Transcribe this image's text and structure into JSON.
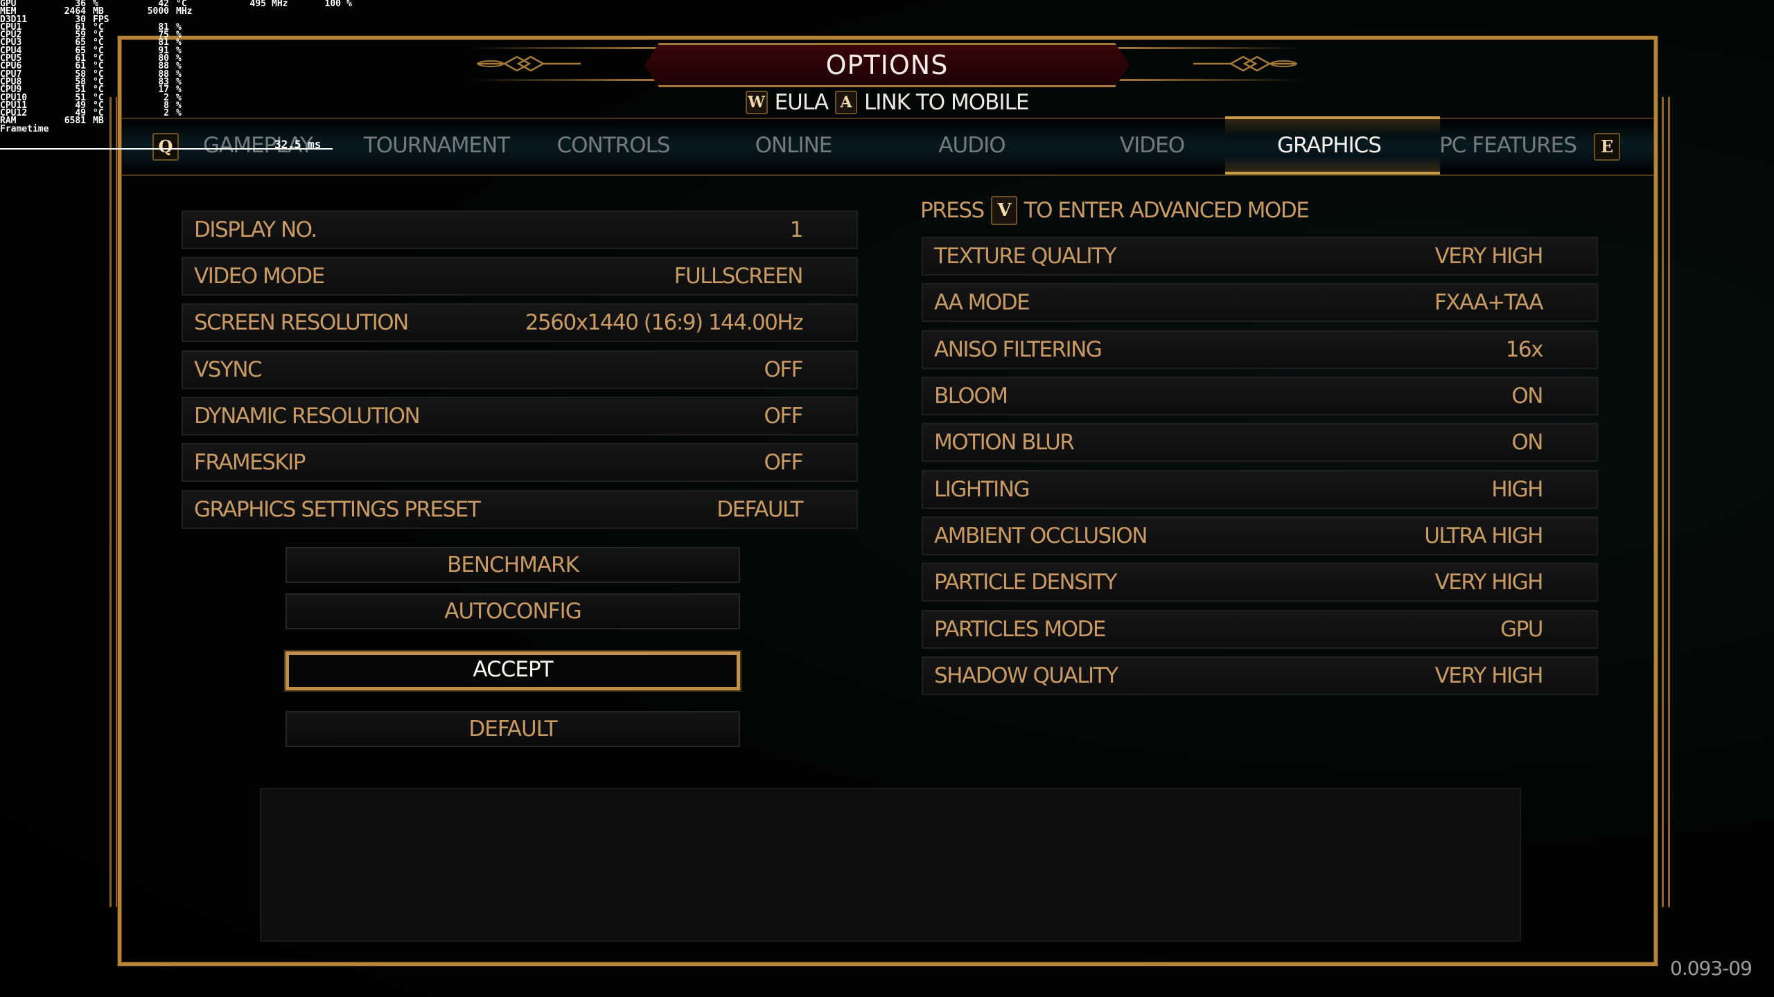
{
  "osd": {
    "rows": [
      [
        "GPU",
        "36",
        "%",
        "42",
        "°C",
        "495",
        "MHz",
        "100",
        "%"
      ],
      [
        "MEM",
        "2464",
        "MB",
        "5000",
        "MHz",
        "",
        "",
        "",
        ""
      ],
      [
        "D3D11",
        "30",
        "FPS",
        "",
        "",
        "",
        "",
        "",
        ""
      ],
      [
        "CPU1",
        "61",
        "°C",
        "81",
        "%",
        "",
        "",
        "",
        ""
      ],
      [
        "CPU2",
        "59",
        "°C",
        "75",
        "%",
        "",
        "",
        "",
        ""
      ],
      [
        "CPU3",
        "65",
        "°C",
        "81",
        "%",
        "",
        "",
        "",
        ""
      ],
      [
        "CPU4",
        "65",
        "°C",
        "91",
        "%",
        "",
        "",
        "",
        ""
      ],
      [
        "CPU5",
        "61",
        "°C",
        "80",
        "%",
        "",
        "",
        "",
        ""
      ],
      [
        "CPU6",
        "61",
        "°C",
        "88",
        "%",
        "",
        "",
        "",
        ""
      ],
      [
        "CPU7",
        "58",
        "°C",
        "88",
        "%",
        "",
        "",
        "",
        ""
      ],
      [
        "CPU8",
        "58",
        "°C",
        "83",
        "%",
        "",
        "",
        "",
        ""
      ],
      [
        "CPU9",
        "51",
        "°C",
        "17",
        "%",
        "",
        "",
        "",
        ""
      ],
      [
        "CPU10",
        "51",
        "°C",
        "2",
        "%",
        "",
        "",
        "",
        ""
      ],
      [
        "CPU11",
        "49",
        "°C",
        "8",
        "%",
        "",
        "",
        "",
        ""
      ],
      [
        "CPU12",
        "49",
        "°C",
        "2",
        "%",
        "",
        "",
        "",
        ""
      ],
      [
        "RAM",
        "6581",
        "MB",
        "",
        "",
        "",
        "",
        "",
        ""
      ],
      [
        "Frametime",
        "",
        "",
        "",
        "",
        "",
        "",
        "",
        ""
      ]
    ],
    "frametime_value": "32.5 ms"
  },
  "header": {
    "title": "OPTIONS",
    "shortcuts": [
      {
        "key": "W",
        "label": "EULA"
      },
      {
        "key": "A",
        "label": "LINK TO MOBILE"
      }
    ]
  },
  "tabs": {
    "prev_key": "Q",
    "next_key": "E",
    "items": [
      {
        "label": "GAMEPLAY",
        "active": false
      },
      {
        "label": "TOURNAMENT",
        "active": false
      },
      {
        "label": "CONTROLS",
        "active": false
      },
      {
        "label": "ONLINE",
        "active": false
      },
      {
        "label": "AUDIO",
        "active": false
      },
      {
        "label": "VIDEO",
        "active": false
      },
      {
        "label": "GRAPHICS",
        "active": true
      },
      {
        "label": "PC FEATURES",
        "active": false
      }
    ]
  },
  "left_settings": [
    {
      "label": "DISPLAY NO.",
      "value": "1"
    },
    {
      "label": "VIDEO MODE",
      "value": "FULLSCREEN"
    },
    {
      "label": "SCREEN RESOLUTION",
      "value": "2560x1440 (16:9) 144.00Hz"
    },
    {
      "label": "VSYNC",
      "value": "OFF"
    },
    {
      "label": "DYNAMIC RESOLUTION",
      "value": "OFF"
    },
    {
      "label": "FRAMESKIP",
      "value": "OFF"
    },
    {
      "label": "GRAPHICS SETTINGS PRESET",
      "value": "DEFAULT"
    }
  ],
  "buttons": {
    "benchmark": "BENCHMARK",
    "autoconfig": "AUTOCONFIG",
    "accept": "ACCEPT",
    "default": "DEFAULT"
  },
  "advanced_hint": {
    "prefix": "PRESS",
    "key": "V",
    "suffix": "TO ENTER ADVANCED MODE"
  },
  "right_settings": [
    {
      "label": "TEXTURE QUALITY",
      "value": "VERY HIGH"
    },
    {
      "label": "AA MODE",
      "value": "FXAA+TAA"
    },
    {
      "label": "ANISO FILTERING",
      "value": "16x"
    },
    {
      "label": "BLOOM",
      "value": "ON"
    },
    {
      "label": "MOTION BLUR",
      "value": "ON"
    },
    {
      "label": "LIGHTING",
      "value": "HIGH"
    },
    {
      "label": "AMBIENT OCCLUSION",
      "value": "ULTRA HIGH"
    },
    {
      "label": "PARTICLE DENSITY",
      "value": "VERY HIGH"
    },
    {
      "label": "PARTICLES MODE",
      "value": "GPU"
    },
    {
      "label": "SHADOW QUALITY",
      "value": "VERY HIGH"
    }
  ],
  "description": "",
  "version": "0.093-09",
  "colors": {
    "gold": "#b7853a",
    "setting_text": "#c99a62",
    "inactive_tab": "#767a7c",
    "active_text": "#f4f1ec",
    "banner_red": "#3a0508"
  }
}
